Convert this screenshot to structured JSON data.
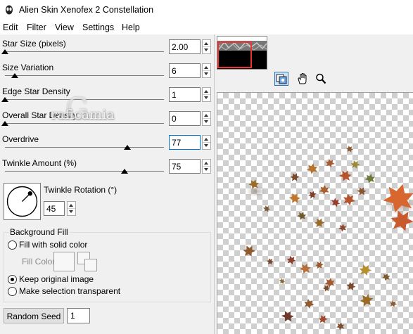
{
  "window": {
    "title": "Alien Skin Xenofex 2 Constellation"
  },
  "menu": [
    "Edit",
    "Filter",
    "View",
    "Settings",
    "Help"
  ],
  "sliders": [
    {
      "label": "Star Size (pixels)",
      "value": "2.00",
      "level": 0.0
    },
    {
      "label": "Size Variation",
      "value": "6",
      "level": 0.06
    },
    {
      "label": "Edge Star Density",
      "value": "1",
      "level": 0.0
    },
    {
      "label": "Overall Star Density",
      "value": "0",
      "level": 0.0
    },
    {
      "label": "Overdrive",
      "value": "77",
      "level": 0.77
    },
    {
      "label": "Twinkle Amount (%)",
      "value": "75",
      "level": 0.75
    }
  ],
  "rotation": {
    "label": "Twinkle Rotation (°)",
    "value": "45",
    "angle_degrees": 45
  },
  "background_fill": {
    "legend": "Background Fill",
    "option_solid": "Fill with solid color",
    "fill_color_label": "Fill Color",
    "option_keep": "Keep original image",
    "option_transparent": "Make selection transparent",
    "selected": "keep"
  },
  "random_seed": {
    "button_label": "Random Seed",
    "value": "1"
  },
  "watermark": {
    "letter": "G",
    "text": "raficamia"
  },
  "colors": {
    "focus": "#0078d7",
    "navigator_rect": "#e33333",
    "accent": "#3a6ea5"
  },
  "tools": [
    "navigator-icon",
    "hand-icon",
    "zoom-icon"
  ]
}
